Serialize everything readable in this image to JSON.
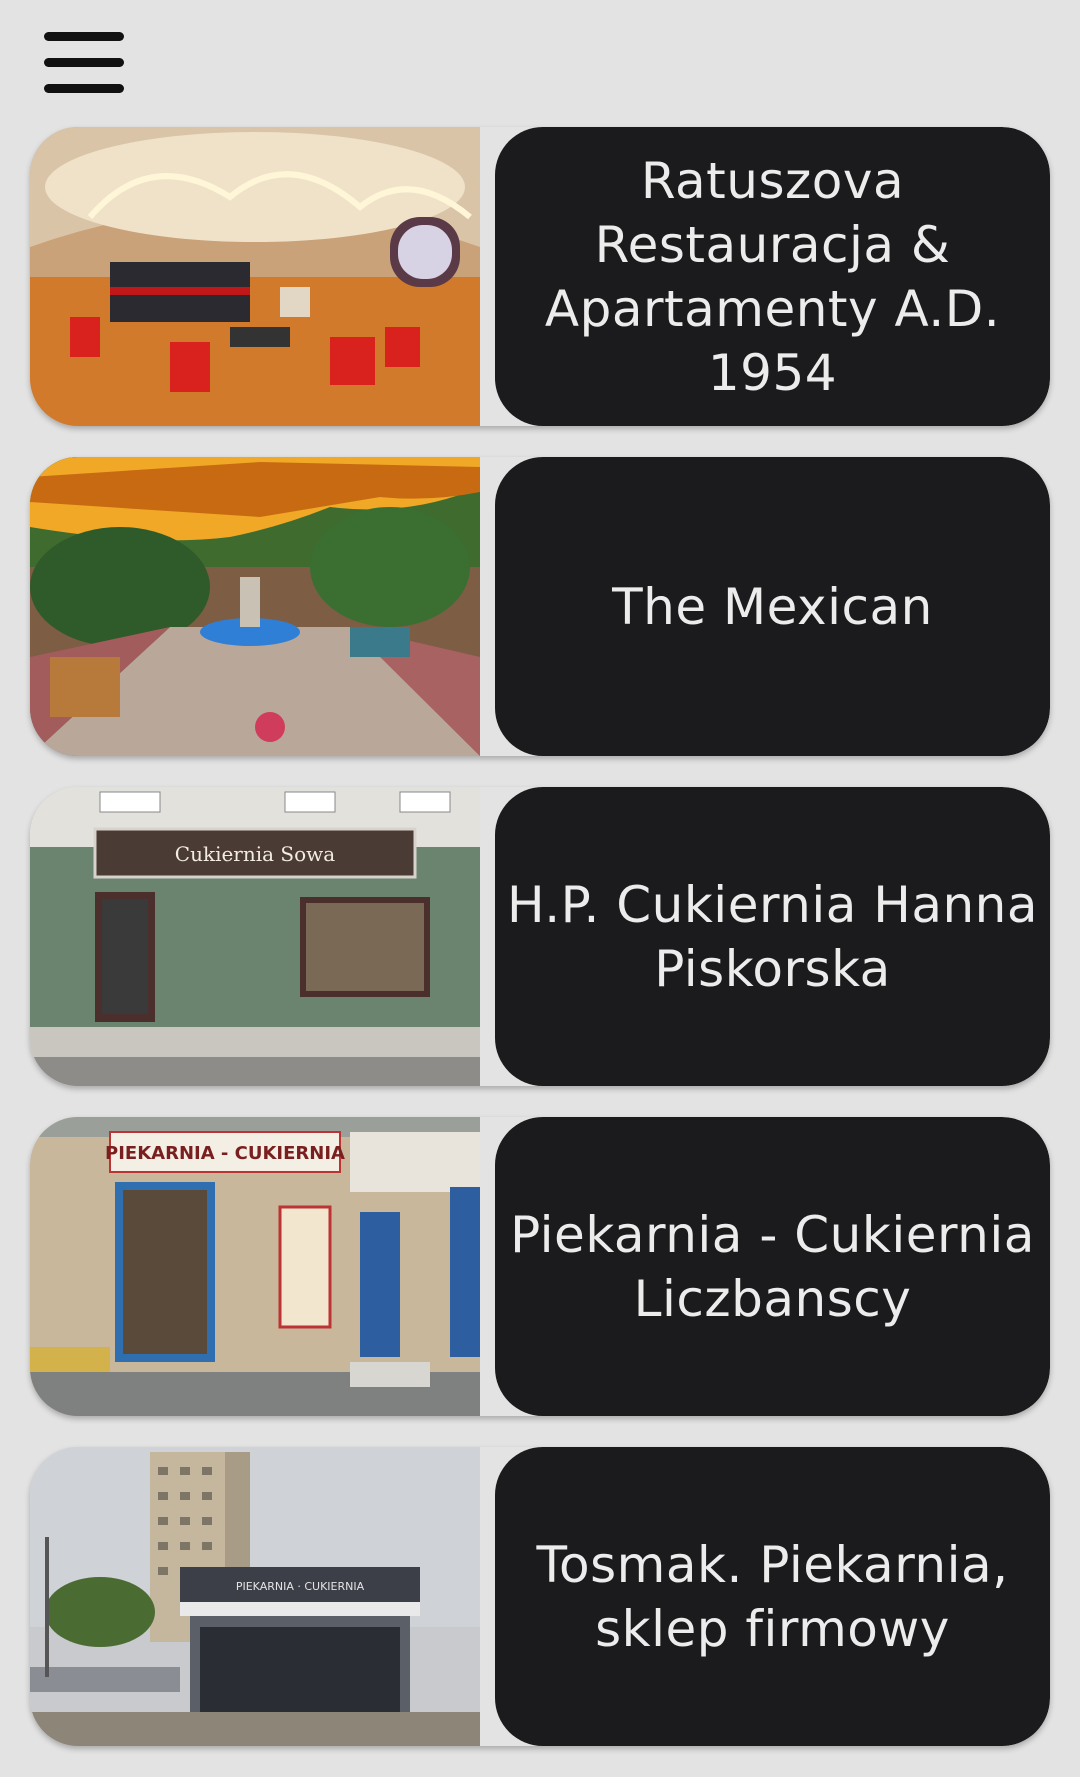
{
  "header": {
    "menu_icon": "hamburger-menu-icon"
  },
  "places": [
    {
      "name": "Ratuszova Restauracja & Apartamenty A.D. 1954",
      "image": "restaurant-interior-panorama"
    },
    {
      "name": "The Mexican",
      "image": "patio-with-fountain"
    },
    {
      "name": "H.P. Cukiernia Hanna Piskorska",
      "image": "cukiernia-sowa-storefront",
      "sign": "Cukiernia Sowa"
    },
    {
      "name": "Piekarnia - Cukiernia Liczbanscy",
      "image": "piekarnia-cukiernia-storefront",
      "sign": "PIEKARNIA - CUKIERNIA"
    },
    {
      "name": "Tosmak. Piekarnia, sklep firmowy",
      "image": "bakery-kiosk-street",
      "sign": "PIEKARNIA · CUKIERNIA"
    }
  ],
  "colors": {
    "background": "#e3e3e3",
    "card_label_bg": "#1b1b1d",
    "card_label_text": "#ececec"
  }
}
